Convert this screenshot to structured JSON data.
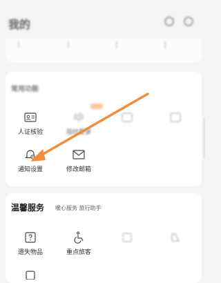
{
  "header": {
    "title": "我的"
  },
  "strip_items": [
    "",
    "",
    "",
    ""
  ],
  "common": {
    "title": "常用功能",
    "subtitle": "",
    "items": [
      {
        "label": "人证核验",
        "icon": "id-card-icon"
      },
      {
        "label": "指纹登录",
        "icon": "fingerprint-icon"
      },
      {
        "label": "",
        "icon": "blurred-icon"
      },
      {
        "label": "",
        "icon": "blurred-icon"
      },
      {
        "label": "通知设置",
        "icon": "notification-settings-icon"
      },
      {
        "label": "修改邮箱",
        "icon": "mail-icon"
      }
    ]
  },
  "warm": {
    "title": "温馨服务",
    "subtitle": "暖心服务 旅行助手",
    "items": [
      {
        "label": "遗失物品",
        "icon": "lost-item-icon"
      },
      {
        "label": "重点旅客",
        "icon": "wheelchair-icon"
      },
      {
        "label": "",
        "icon": "blurred-icon"
      },
      {
        "label": "",
        "icon": "blurred-icon"
      }
    ]
  },
  "colors": {
    "arrow": "#f28d3c",
    "accent_badge": "#ffb37a"
  }
}
